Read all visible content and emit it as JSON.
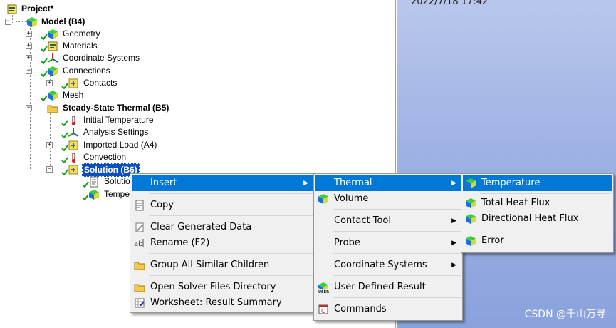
{
  "viewport": {
    "timestamp": "2022/7/18 17:42",
    "watermark": "CSDN @千山万寻"
  },
  "tree": {
    "project": "Project*",
    "model": "Model (B4)",
    "geometry": "Geometry",
    "materials": "Materials",
    "coordinate_systems": "Coordinate Systems",
    "connections": "Connections",
    "contacts": "Contacts",
    "mesh": "Mesh",
    "analysis": "Steady-State Thermal (B5)",
    "initial_temperature": "Initial Temperature",
    "analysis_settings": "Analysis Settings",
    "imported_load": "Imported Load (A4)",
    "convection": "Convection",
    "solution": "Solution (B6)",
    "solution_information": "Solution",
    "temperature": "Temper"
  },
  "context_menu": {
    "insert": "Insert",
    "copy": "Copy",
    "clear_generated_data": "Clear Generated Data",
    "rename": "Rename (F2)",
    "group_all": "Group All Similar Children",
    "open_solver_dir": "Open Solver Files Directory",
    "worksheet": "Worksheet: Result Summary"
  },
  "insert_menu": {
    "thermal": "Thermal",
    "volume": "Volume",
    "contact_tool": "Contact Tool",
    "probe": "Probe",
    "coordinate_systems": "Coordinate Systems",
    "user_defined_result": "User Defined Result",
    "commands": "Commands"
  },
  "thermal_menu": {
    "temperature": "Temperature",
    "total_heat_flux": "Total Heat Flux",
    "directional_heat_flux": "Directional Heat Flux",
    "error": "Error"
  },
  "colors": {
    "highlight": "#0078d7",
    "selection": "#0a4fbf",
    "viewport": "#9fb2e4"
  }
}
